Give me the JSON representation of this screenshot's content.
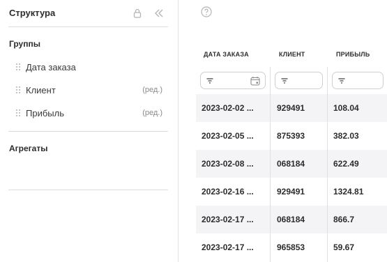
{
  "panel": {
    "title": "Структура",
    "groups_title": "Группы",
    "aggregates_title": "Агрегаты",
    "fields": [
      {
        "label": "Дата заказа",
        "edit": ""
      },
      {
        "label": "Клиент",
        "edit": "(ред.)"
      },
      {
        "label": "Прибыль",
        "edit": "(ред.)"
      }
    ]
  },
  "table": {
    "columns": [
      "ДАТА ЗАКАЗА",
      "КЛИЕНТ",
      "ПРИБЫЛЬ"
    ],
    "rows": [
      [
        "2023-02-02 ...",
        "929491",
        "108.04"
      ],
      [
        "2023-02-05 ...",
        "875393",
        "382.03"
      ],
      [
        "2023-02-08 ...",
        "068184",
        "622.49"
      ],
      [
        "2023-02-16 ...",
        "929491",
        "1324.81"
      ],
      [
        "2023-02-17 ...",
        "068184",
        "866.7"
      ],
      [
        "2023-02-17 ...",
        "965853",
        "59.67"
      ]
    ]
  },
  "icons": {
    "lock": "lock-icon",
    "collapse": "double-chevron-left-icon",
    "help": "help-circle-icon",
    "filter": "filter-icon",
    "calendar": "calendar-icon",
    "grip": "drag-handle-icon"
  },
  "colors": {
    "row_shade": "#f4f4f6",
    "icon_gray": "#b5b5b5",
    "divider": "#dcdcdc"
  }
}
